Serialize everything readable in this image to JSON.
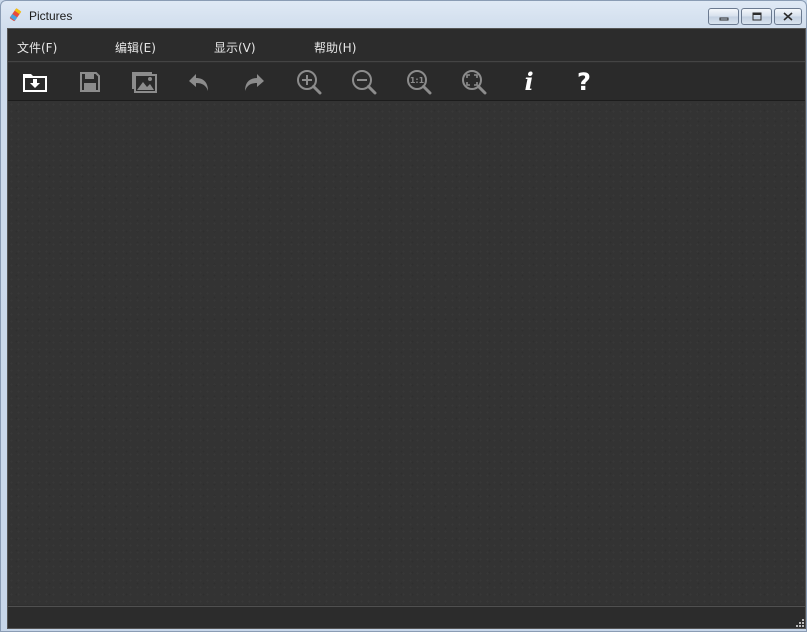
{
  "window": {
    "title": "Pictures",
    "app_icon": "pencil-eraser-icon",
    "controls": [
      "minimize-icon",
      "maximize-icon",
      "close-icon"
    ]
  },
  "menu": {
    "file": "文件(F)",
    "edit": "编辑(E)",
    "view": "显示(V)",
    "help": "帮助(H)"
  },
  "toolbar": {
    "icons": [
      "open-folder-icon",
      "save-icon",
      "gallery-icon",
      "undo-icon",
      "redo-icon",
      "zoom-in-icon",
      "zoom-out-icon",
      "actual-size-icon",
      "fit-screen-icon",
      "info-icon",
      "help-icon"
    ],
    "actual_size_text": "1:1",
    "info_glyph": "i",
    "help_glyph": "?"
  },
  "colors": {
    "background": "#333333",
    "toolbar": "#2a2a2a",
    "icon_active": "#ffffff",
    "icon_disabled": "#8c8c8c"
  }
}
